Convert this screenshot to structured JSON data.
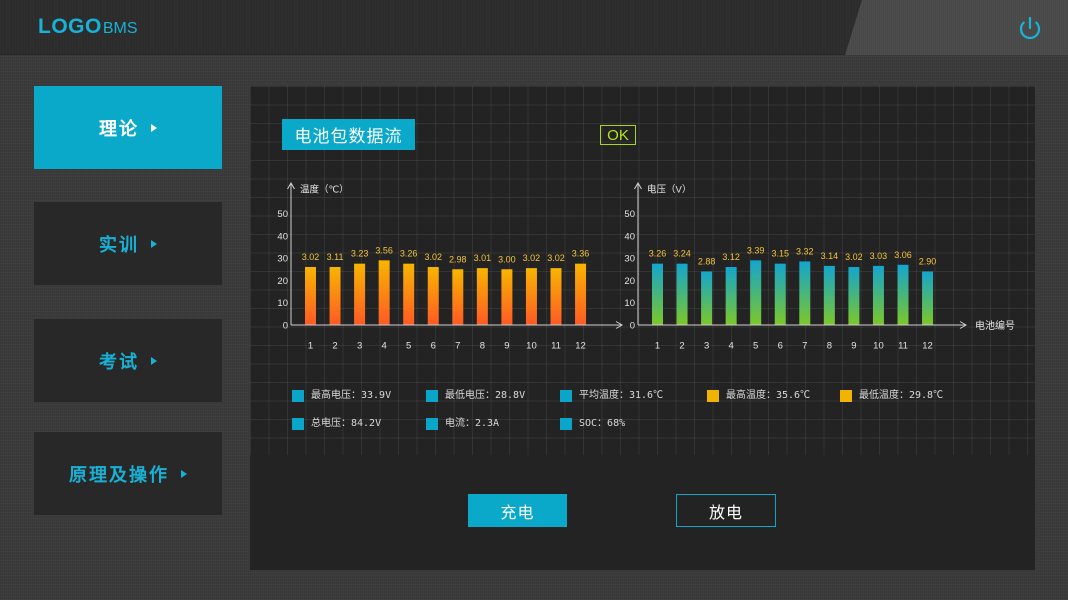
{
  "header": {
    "logo_main": "LOGO",
    "logo_sub": "BMS",
    "power_icon": "power-icon"
  },
  "sidebar": {
    "items": [
      {
        "label": "理论",
        "active": true,
        "icon": "triangle-right-icon"
      },
      {
        "label": "实训",
        "active": false,
        "icon": "triangle-right-icon"
      },
      {
        "label": "考试",
        "active": false,
        "icon": "triangle-right-icon"
      },
      {
        "label": "原理及操作",
        "active": false,
        "icon": "triangle-right-icon"
      }
    ]
  },
  "panel": {
    "title": "电池包数据流",
    "status": "OK"
  },
  "chart_data": [
    {
      "type": "bar",
      "xlabel": "",
      "ylabel": "温度（℃）",
      "categories": [
        "1",
        "2",
        "3",
        "4",
        "5",
        "6",
        "7",
        "8",
        "9",
        "10",
        "11",
        "12"
      ],
      "values": [
        26,
        26,
        27.5,
        29,
        27.5,
        26,
        25,
        25.5,
        25,
        25.5,
        25.5,
        27.5
      ],
      "data_labels": [
        "3.02",
        "3.11",
        "3.23",
        "3.56",
        "3.26",
        "3.02",
        "2.98",
        "3.01",
        "3.00",
        "3.02",
        "3.02",
        "3.36"
      ],
      "yticks": [
        0,
        10,
        20,
        30,
        40,
        50
      ],
      "ylim": [
        0,
        50
      ],
      "bar_gradient": [
        "#f7b500",
        "#ff5a24"
      ]
    },
    {
      "type": "bar",
      "xlabel": "电池编号",
      "ylabel": "电压（V）",
      "categories": [
        "1",
        "2",
        "3",
        "4",
        "5",
        "6",
        "7",
        "8",
        "9",
        "10",
        "11",
        "12"
      ],
      "values": [
        27.5,
        27.5,
        24,
        26,
        29,
        27.5,
        28.5,
        26.5,
        26,
        26.5,
        27,
        24
      ],
      "data_labels": [
        "3.26",
        "3.24",
        "2.88",
        "3.12",
        "3.39",
        "3.15",
        "3.32",
        "3.14",
        "3.02",
        "3.03",
        "3.06",
        "2.90"
      ],
      "yticks": [
        0,
        10,
        20,
        30,
        40,
        50
      ],
      "ylim": [
        0,
        50
      ],
      "bar_gradient": [
        "#13a5cd",
        "#7cc72a"
      ]
    }
  ],
  "legend": {
    "items": [
      {
        "text": "最高电压：33.9V",
        "color": "#0aa5c8"
      },
      {
        "text": "最低电压：28.8V",
        "color": "#0aa5c8"
      },
      {
        "text": "平均温度：31.6℃",
        "color": "#0aa5c8"
      },
      {
        "text": "最高温度：35.6℃",
        "color": "#f0b400"
      },
      {
        "text": "最低温度：29.8℃",
        "color": "#f0b400"
      },
      {
        "text": "总电压：84.2V",
        "color": "#0aa5c8"
      },
      {
        "text": "电流：2.3A",
        "color": "#0aa5c8"
      },
      {
        "text": "SOC：68%",
        "color": "#0aa5c8"
      }
    ]
  },
  "actions": {
    "charge_label": "充电",
    "discharge_label": "放电"
  },
  "colors": {
    "accent": "#0aa8c9",
    "status_ok": "#b2e522",
    "panel_bg": "#232323"
  }
}
